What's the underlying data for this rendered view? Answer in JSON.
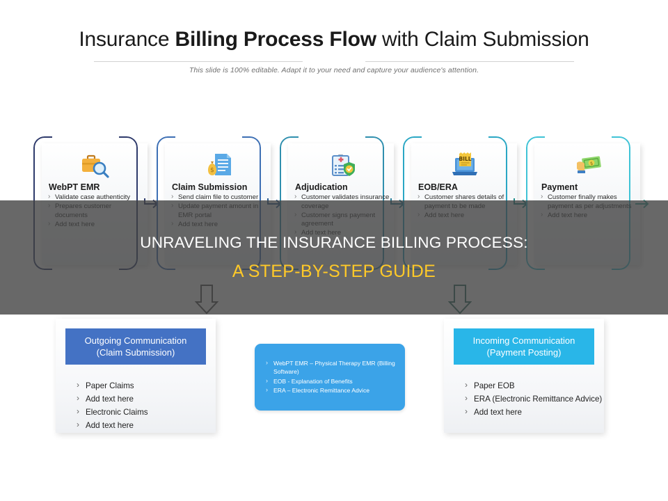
{
  "header": {
    "title_part1": "Insurance ",
    "title_bold": "Billing Process Flow",
    "title_part2": " with Claim Submission",
    "subtitle": "This slide is 100% editable. Adapt it to your need and capture your audience's attention."
  },
  "colors": {
    "step1_border": "#2e3a6b",
    "step2_border": "#3d6fb4",
    "step3_border": "#2f8fae",
    "step4_border": "#2aa7c4",
    "step5_border": "#3fc3d6",
    "outgoing_header": "#4472c4",
    "incoming_header": "#29b6e8",
    "center_box": "#3ba3e8",
    "overlay_bg": "#3f3f3f",
    "overlay_line1": "#ffffff",
    "overlay_line2": "#ffc928"
  },
  "process": {
    "steps": [
      {
        "title": "WebPT EMR",
        "icon": "briefcase-search-icon",
        "bullets": [
          "Validate case authenticity",
          "Prepares customer documents",
          "Add text here"
        ]
      },
      {
        "title": "Claim Submission",
        "icon": "document-moneybag-icon",
        "bullets": [
          "Send claim file to customer",
          "Update payment amount in EMR portal",
          "Add text here"
        ]
      },
      {
        "title": "Adjudication",
        "icon": "medical-clipboard-shield-icon",
        "bullets": [
          "Customer validates insurance coverage",
          "Customer signs payment agreement",
          "Add text here"
        ]
      },
      {
        "title": "EOB/ERA",
        "icon": "laptop-bill-icon",
        "bullets": [
          "Customer shares details of payment to be made",
          "Add text here"
        ]
      },
      {
        "title": "Payment",
        "icon": "hand-cash-icon",
        "bullets": [
          "Customer finally makes payment as per adjustments",
          "Add text here"
        ]
      }
    ]
  },
  "panels": {
    "outgoing": {
      "heading_line1": "Outgoing Communication",
      "heading_line2": "(Claim Submission)",
      "bullets": [
        "Paper Claims",
        "Add text here",
        "Electronic Claims",
        "Add text here"
      ]
    },
    "incoming": {
      "heading_line1": "Incoming Communication",
      "heading_line2": "(Payment Posting)",
      "bullets": [
        "Paper EOB",
        "ERA (Electronic Remittance Advice)",
        "Add text here"
      ]
    },
    "legend": {
      "bullets": [
        "WebPT EMR – Physical Therapy EMR (Billing Software)",
        "EOB - Explanation of Benefits",
        "ERA – Electronic Remittance Advice"
      ]
    }
  },
  "overlay": {
    "line1": "UNRAVELING THE INSURANCE BILLING PROCESS:",
    "line2": "A STEP-BY-STEP GUIDE"
  }
}
